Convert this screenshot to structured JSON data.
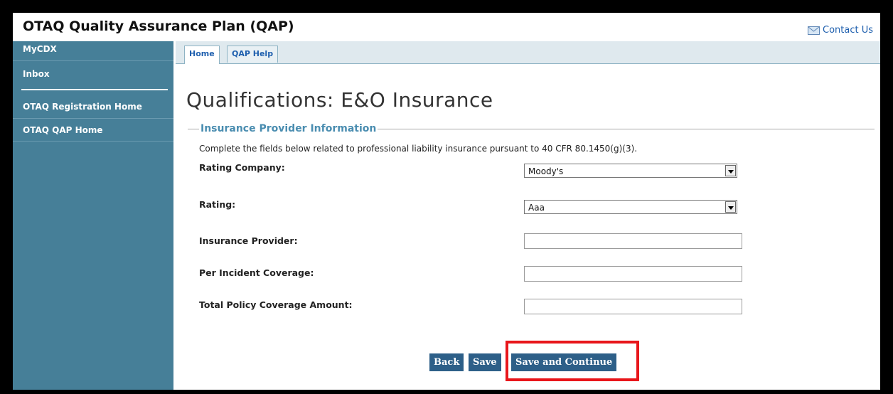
{
  "app": {
    "title": "OTAQ Quality Assurance Plan (QAP)",
    "contact_label": "Contact Us"
  },
  "sidebar": {
    "items": [
      {
        "label": "MyCDX"
      },
      {
        "label": "Inbox"
      },
      {
        "label": "OTAQ Registration Home"
      },
      {
        "label": "OTAQ QAP Home"
      }
    ]
  },
  "tabs": [
    {
      "label": "Home",
      "active": true
    },
    {
      "label": "QAP Help",
      "active": false
    }
  ],
  "page": {
    "title": "Qualifications: E&O Insurance"
  },
  "section": {
    "legend": "Insurance Provider Information",
    "instructions": "Complete the fields below related to professional liability insurance pursuant to 40 CFR 80.1450(g)(3)."
  },
  "form": {
    "rating_company": {
      "label": "Rating Company:",
      "value": "Moody's"
    },
    "rating": {
      "label": "Rating:",
      "value": "Aaa"
    },
    "insurance_provider": {
      "label": "Insurance Provider:",
      "value": ""
    },
    "per_incident": {
      "label": "Per Incident Coverage:",
      "value": ""
    },
    "total_policy": {
      "label": "Total Policy Coverage Amount:",
      "value": ""
    }
  },
  "buttons": {
    "back": "Back",
    "save": "Save",
    "save_continue": "Save and Continue"
  },
  "colors": {
    "sidebar": "#467f98",
    "button": "#2d5f88",
    "highlight": "#e8161b",
    "accent_text": "#1e5fae"
  }
}
